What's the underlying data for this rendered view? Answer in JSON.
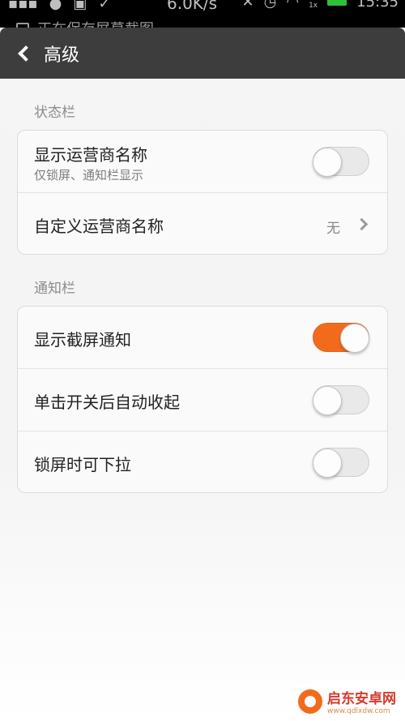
{
  "status_bar": {
    "speed": "6.0K/s",
    "time": "15:35",
    "network": "1x",
    "ticker": "正在保存屏幕截图"
  },
  "header": {
    "title": "高级"
  },
  "sections": {
    "status_bar": {
      "label": "状态栏",
      "rows": {
        "show_carrier": {
          "title": "显示运营商名称",
          "subtitle": "仅锁屏、通知栏显示",
          "on": false
        },
        "custom_carrier": {
          "title": "自定义运营商名称",
          "value": "无"
        }
      }
    },
    "notification_bar": {
      "label": "通知栏",
      "rows": {
        "screenshot_notify": {
          "title": "显示截屏通知",
          "on": true
        },
        "auto_collapse": {
          "title": "单击开关后自动收起",
          "on": false
        },
        "lock_pulldown": {
          "title": "锁屏时可下拉",
          "on": false
        }
      }
    }
  },
  "watermark": {
    "name": "启东安卓网",
    "url": "www.qdlxdw.com"
  },
  "colors": {
    "accent": "#f26b1d",
    "header_bg": "#3d3d3d"
  }
}
